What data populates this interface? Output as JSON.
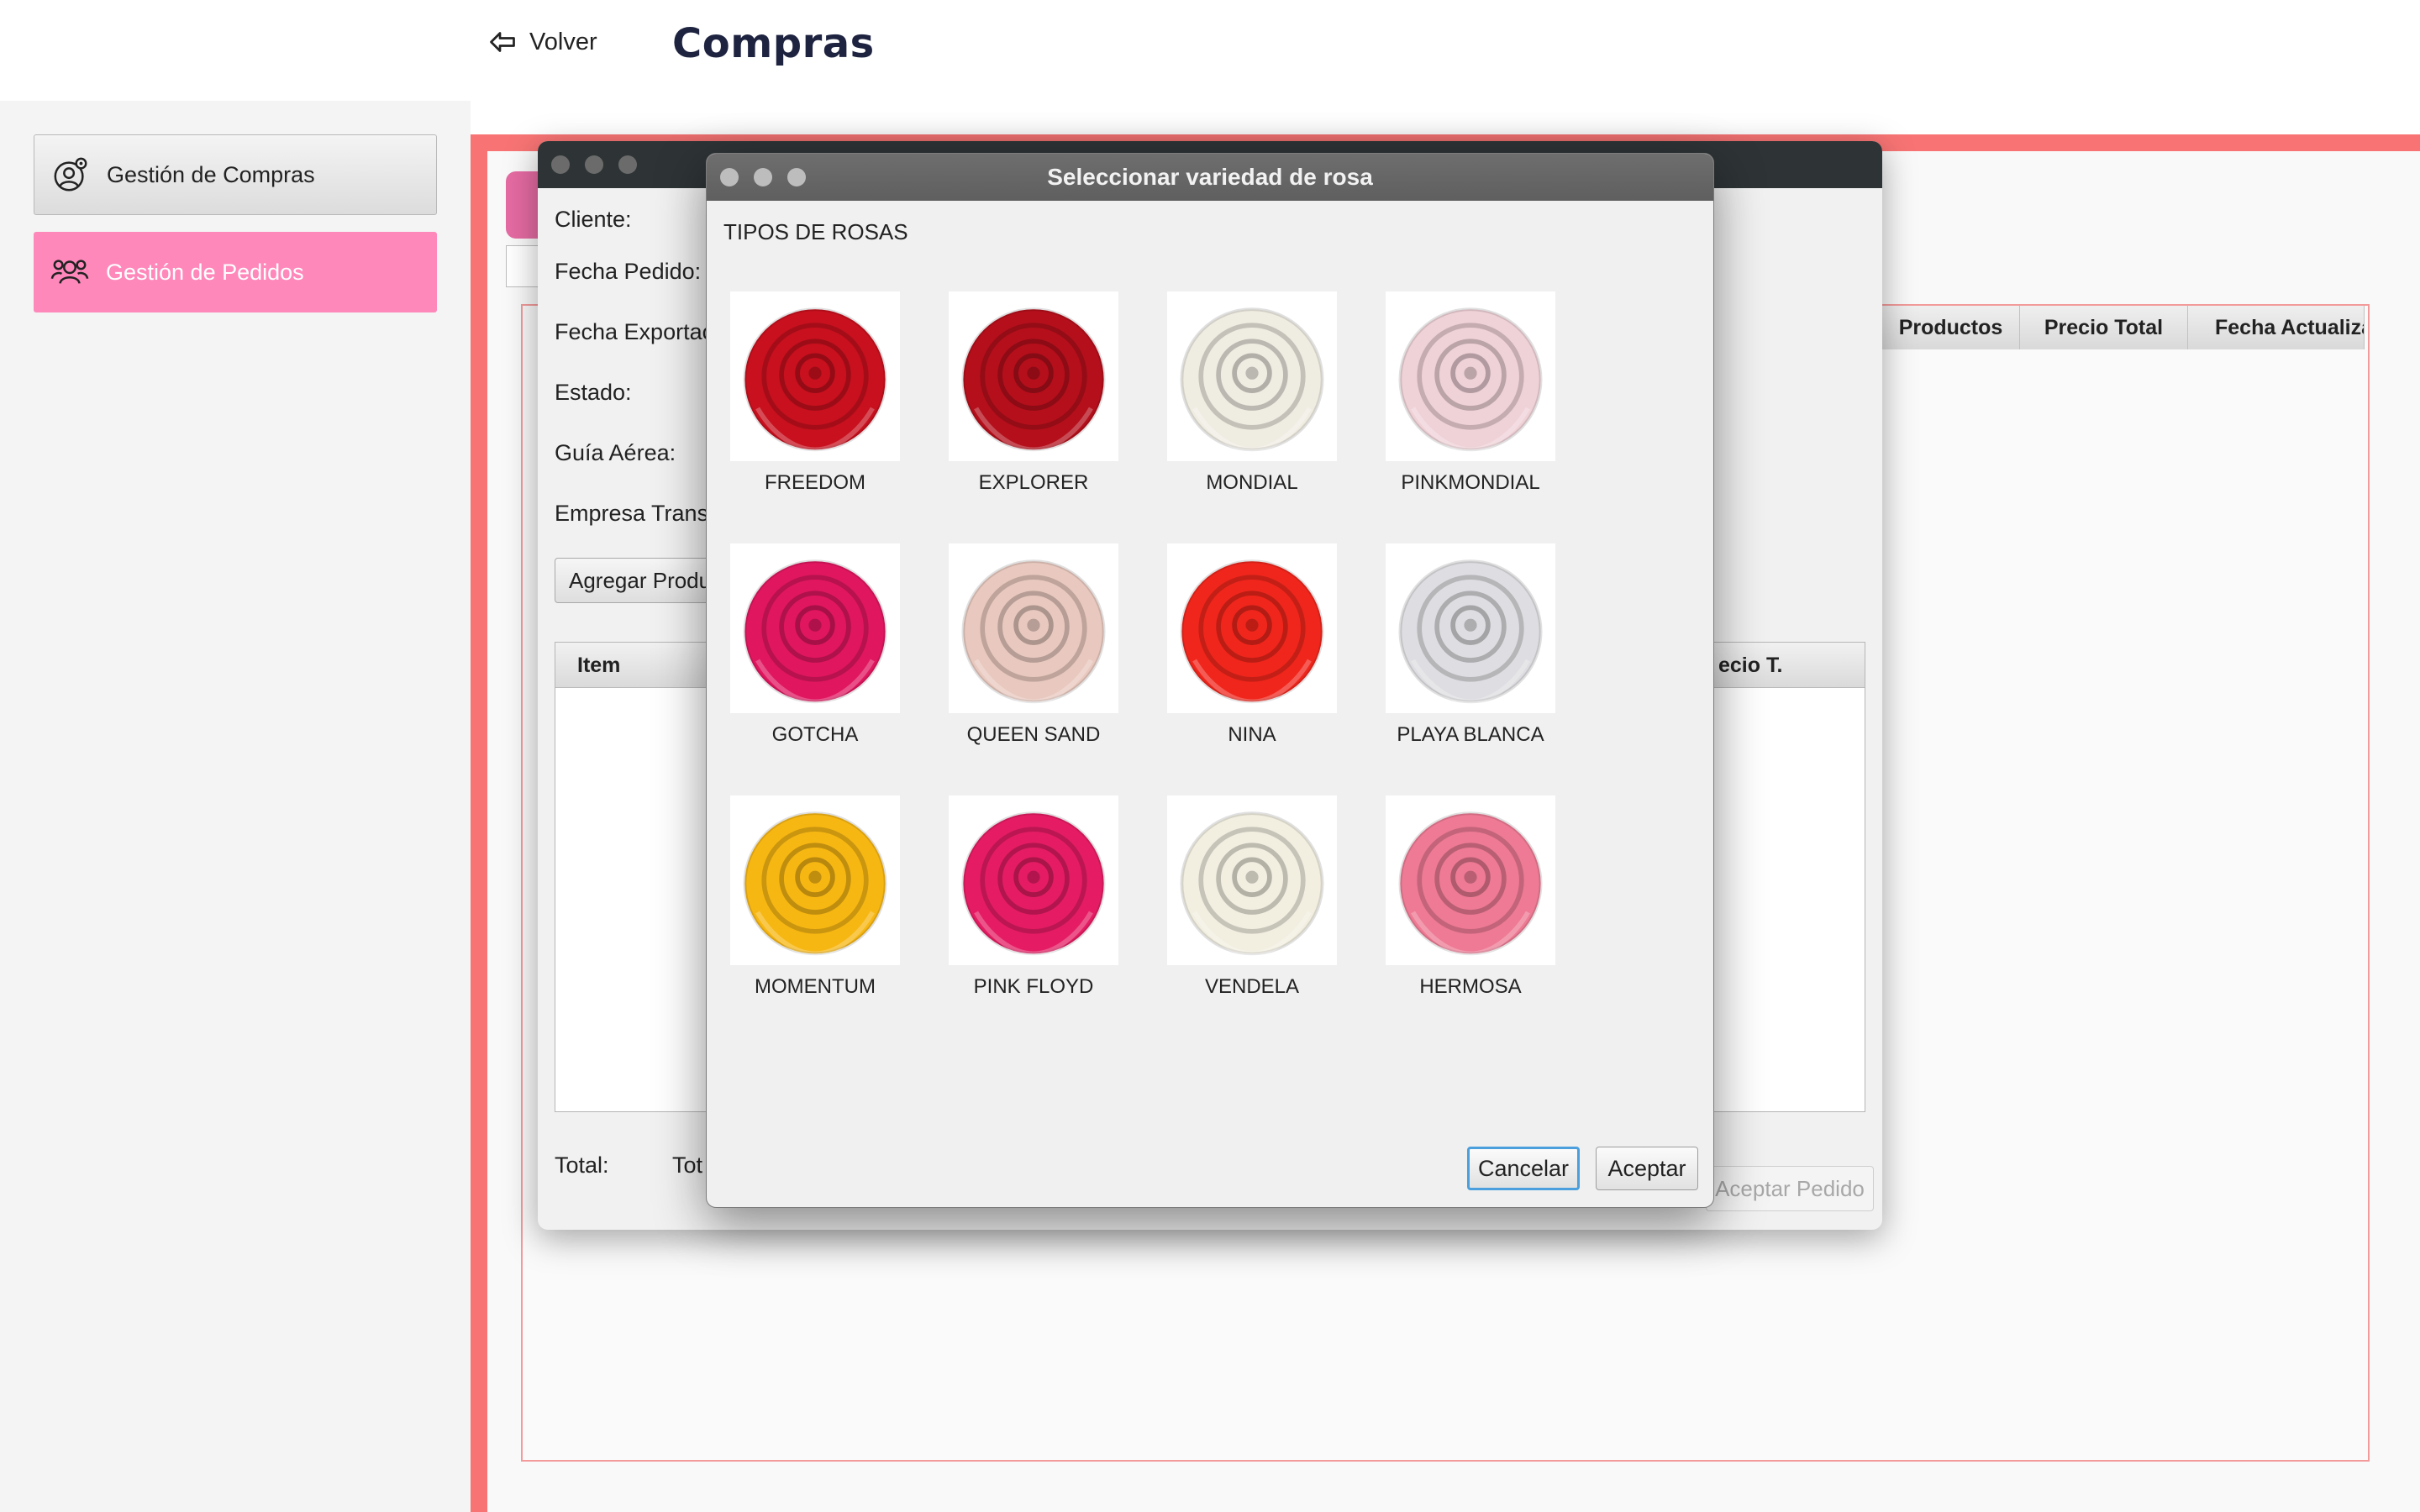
{
  "header": {
    "back_label": "Volver",
    "title": "Compras"
  },
  "sidebar": {
    "items": [
      {
        "label": "Gestión de Compras",
        "icon": "user-gear-icon",
        "active": false
      },
      {
        "label": "Gestión de Pedidos",
        "icon": "users-icon",
        "active": true
      }
    ]
  },
  "background_table": {
    "columns": [
      "Productos",
      "Precio Total",
      "Fecha Actualiza"
    ]
  },
  "pedido_dialog": {
    "fields": [
      "Cliente:",
      "Fecha Pedido:",
      "Fecha Exportació",
      "Estado:",
      "Guía Aérea:",
      "Empresa Transp"
    ],
    "add_product_button": "Agregar Produc",
    "table_columns": [
      "Item",
      "ecio T."
    ],
    "total_label": "Total:",
    "total_label_2": "Tot",
    "accept_order_button": "Aceptar Pedido"
  },
  "rose_dialog": {
    "title": "Seleccionar variedad de rosa",
    "section_label": "TIPOS DE ROSAS",
    "roses": [
      {
        "name": "FREEDOM",
        "color": "#c8101e"
      },
      {
        "name": "EXPLORER",
        "color": "#b40f1b"
      },
      {
        "name": "MONDIAL",
        "color": "#efece2"
      },
      {
        "name": "PINKMONDIAL",
        "color": "#efd2d8"
      },
      {
        "name": "GOTCHA",
        "color": "#e0165f"
      },
      {
        "name": "QUEEN SAND",
        "color": "#e9c9bf"
      },
      {
        "name": "NINA",
        "color": "#f0261c"
      },
      {
        "name": "PLAYA BLANCA",
        "color": "#dedee2"
      },
      {
        "name": "MOMENTUM",
        "color": "#f7b713"
      },
      {
        "name": "PINK FLOYD",
        "color": "#e51c63"
      },
      {
        "name": "VENDELA",
        "color": "#f2efe1"
      },
      {
        "name": "HERMOSA",
        "color": "#ee7a95"
      }
    ],
    "cancel_button": "Cancelar",
    "accept_button": "Aceptar"
  },
  "colors": {
    "accent_pink": "#ff88bb",
    "frame_red": "#f87474",
    "title_navy": "#1e2340",
    "focus_blue": "#4a9fdc"
  }
}
